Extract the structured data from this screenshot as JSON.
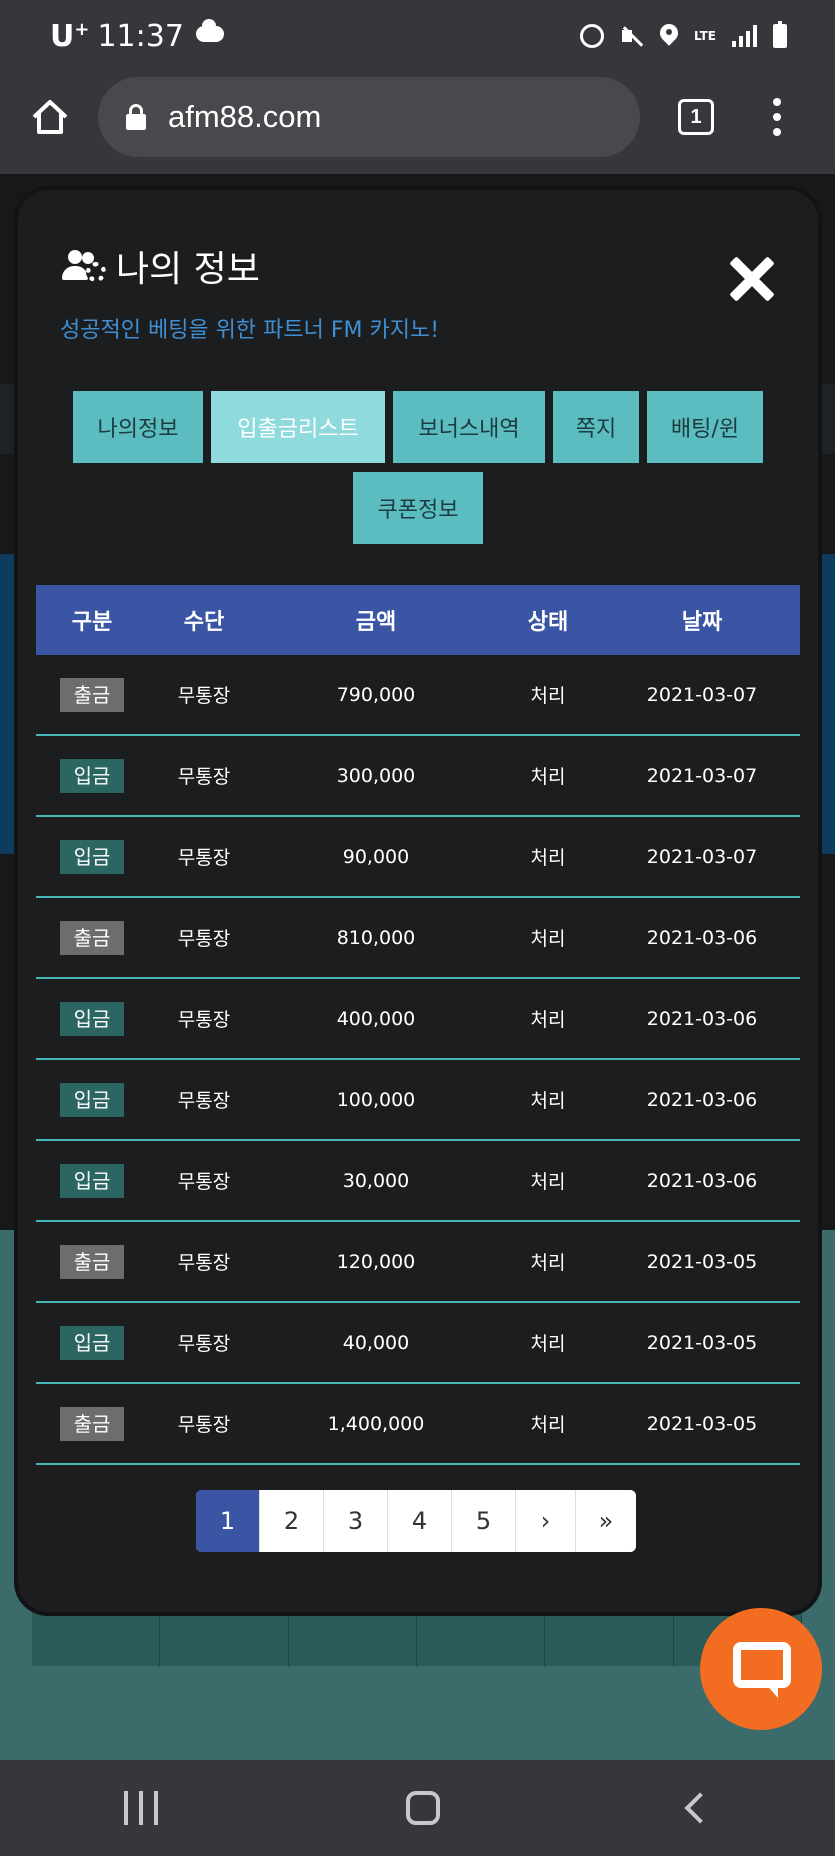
{
  "status_bar": {
    "carrier": "U",
    "carrier_plus": "+",
    "time": "11:37",
    "network": "LTE"
  },
  "browser": {
    "url": "afm88.com",
    "tab_count": "1"
  },
  "modal": {
    "title": "나의 정보",
    "subtitle": "성공적인 베팅을 위한 파트너 FM 카지노!",
    "tabs": [
      {
        "label": "나의정보"
      },
      {
        "label": "입출금리스트"
      },
      {
        "label": "보너스내역"
      },
      {
        "label": "쪽지"
      },
      {
        "label": "배팅/윈"
      },
      {
        "label": "쿠폰정보"
      }
    ],
    "active_tab": "입출금리스트",
    "table": {
      "headers": [
        "구분",
        "수단",
        "금액",
        "상태",
        "날짜"
      ],
      "rows": [
        {
          "type": "출금",
          "kind": "out",
          "method": "무통장",
          "amount": "790,000",
          "status": "처리",
          "date": "2021-03-07"
        },
        {
          "type": "입금",
          "kind": "in",
          "method": "무통장",
          "amount": "300,000",
          "status": "처리",
          "date": "2021-03-07"
        },
        {
          "type": "입금",
          "kind": "in",
          "method": "무통장",
          "amount": "90,000",
          "status": "처리",
          "date": "2021-03-07"
        },
        {
          "type": "출금",
          "kind": "out",
          "method": "무통장",
          "amount": "810,000",
          "status": "처리",
          "date": "2021-03-06"
        },
        {
          "type": "입금",
          "kind": "in",
          "method": "무통장",
          "amount": "400,000",
          "status": "처리",
          "date": "2021-03-06"
        },
        {
          "type": "입금",
          "kind": "in",
          "method": "무통장",
          "amount": "100,000",
          "status": "처리",
          "date": "2021-03-06"
        },
        {
          "type": "입금",
          "kind": "in",
          "method": "무통장",
          "amount": "30,000",
          "status": "처리",
          "date": "2021-03-06"
        },
        {
          "type": "출금",
          "kind": "out",
          "method": "무통장",
          "amount": "120,000",
          "status": "처리",
          "date": "2021-03-05"
        },
        {
          "type": "입금",
          "kind": "in",
          "method": "무통장",
          "amount": "40,000",
          "status": "처리",
          "date": "2021-03-05"
        },
        {
          "type": "출금",
          "kind": "out",
          "method": "무통장",
          "amount": "1,400,000",
          "status": "처리",
          "date": "2021-03-05"
        }
      ]
    },
    "pagination": {
      "pages": [
        "1",
        "2",
        "3",
        "4",
        "5"
      ],
      "current": "1",
      "next": "›",
      "last": "»"
    }
  },
  "colors": {
    "accent_blue": "#3a55a4",
    "tab_teal": "#5bbdbf",
    "tab_active": "#8fdadd",
    "deposit_badge": "#2c6663",
    "withdraw_badge": "#6b6d6e",
    "subtitle_blue": "#3f8fd4",
    "chat_orange": "#f26d21"
  }
}
